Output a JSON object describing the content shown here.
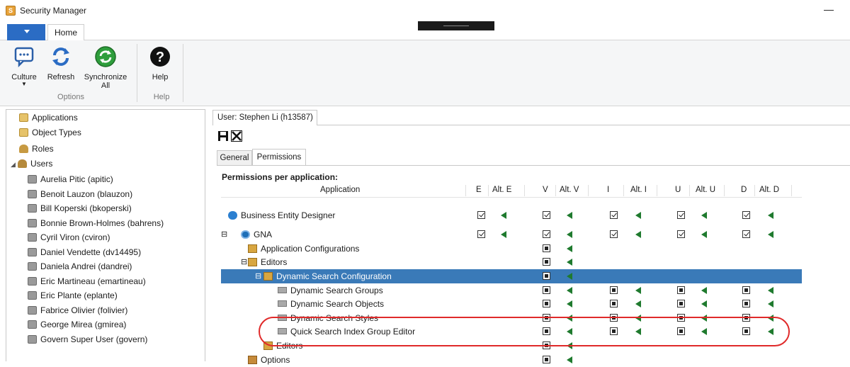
{
  "window": {
    "title": "Security Manager",
    "app_icon_letter": "S"
  },
  "ribbon": {
    "tabs": [
      "Home"
    ],
    "buttons": {
      "culture": "Culture",
      "refresh": "Refresh",
      "synchronize": "Synchronize All",
      "help": "Help"
    },
    "groups": {
      "options": "Options",
      "help": "Help"
    }
  },
  "tree": {
    "items": [
      {
        "label": "Applications"
      },
      {
        "label": "Object Types"
      },
      {
        "label": "Roles"
      },
      {
        "label": "Users"
      }
    ],
    "users": [
      "Aurelia Pitic (apitic)",
      "Benoit Lauzon (blauzon)",
      "Bill Koperski (bkoperski)",
      "Bonnie Brown-Holmes (bahrens)",
      "Cyril Viron (cviron)",
      "Daniel Vendette (dv14495)",
      "Daniela Andrei (dandrei)",
      "Eric Martineau (emartineau)",
      "Eric Plante (eplante)",
      "Fabrice Olivier (folivier)",
      "George Mirea (gmirea)",
      "Govern Super User (govern)"
    ]
  },
  "detail": {
    "user_tab": "User: Stephen Li (h13587)",
    "tabs": {
      "general": "General",
      "permissions": "Permissions"
    },
    "heading": "Permissions per application:",
    "columns": [
      "Application",
      "E",
      "Alt. E",
      "V",
      "Alt. V",
      "I",
      "Alt. I",
      "U",
      "Alt. U",
      "D",
      "Alt. D"
    ],
    "rows": [
      {
        "label": "Business Entity Designer"
      },
      {
        "label": "GNA"
      },
      {
        "label": "Application Configurations"
      },
      {
        "label": "Editors"
      },
      {
        "label": "Dynamic Search Configuration"
      },
      {
        "label": "Dynamic Search Groups"
      },
      {
        "label": "Dynamic Search Objects"
      },
      {
        "label": "Dynamic Search Styles"
      },
      {
        "label": "Quick Search Index Group Editor"
      },
      {
        "label": "Editors"
      },
      {
        "label": "Options"
      }
    ]
  },
  "colors": {
    "accent": "#2b6cc4",
    "selection": "#3a7ab8",
    "highlight": "#e02a2a",
    "grant_arrow": "#1f7a2e"
  },
  "icons": [
    "culture-icon",
    "refresh-icon",
    "synchronize-icon",
    "help-icon",
    "save-icon",
    "close-icon"
  ]
}
